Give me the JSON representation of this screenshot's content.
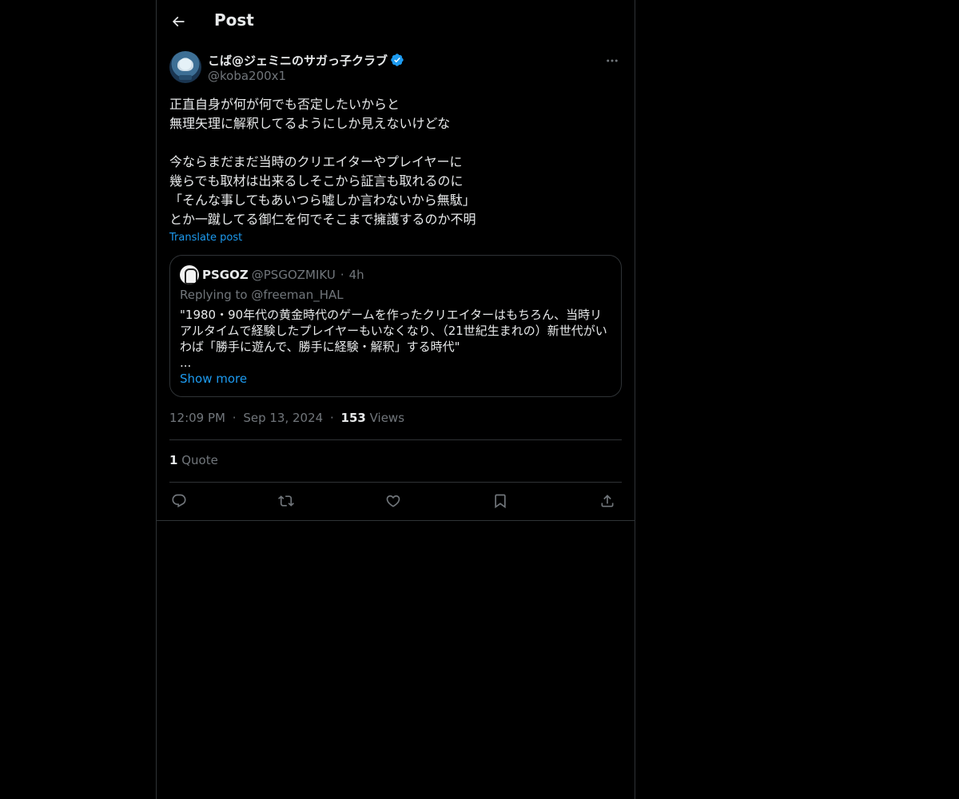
{
  "header": {
    "title": "Post"
  },
  "author": {
    "display_name": "こば@ジェミニのサガっ子クラブ",
    "handle": "@koba200x1",
    "verified": true
  },
  "post": {
    "text": "正直自身が何が何でも否定したいからと\n無理矢理に解釈してるようにしか見えないけどな\n\n今ならまだまだ当時のクリエイターやプレイヤーに\n幾らでも取材は出来るしそこから証言も取れるのに\n「そんな事してもあいつら嘘しか言わないから無駄」\nとか一蹴してる御仁を何でそこまで擁護するのか不明",
    "translate_label": "Translate post"
  },
  "quote": {
    "name": "PSGOZ",
    "handle": "@PSGOZMIKU",
    "separator": "·",
    "time": "4h",
    "replying_to": "Replying to @freeman_HAL",
    "text": "\"1980・90年代の黄金時代のゲームを作ったクリエイターはもちろん、当時リアルタイムで経験したプレイヤーもいなくなり、（21世紀生まれの）新世代がいわば「勝手に遊んで、勝手に経験・解釈」する時代\"\n...",
    "show_more": "Show more"
  },
  "meta": {
    "time": "12:09 PM",
    "separator": "·",
    "date": "Sep 13, 2024",
    "views_count": "153",
    "views_label": "Views"
  },
  "stats": {
    "quote_count": "1",
    "quote_label": "Quote"
  },
  "actions": [
    "reply-icon",
    "repost-icon",
    "like-icon",
    "bookmark-icon",
    "share-icon"
  ],
  "colors": {
    "background": "#000000",
    "text": "#e7e9ea",
    "secondary": "#71767b",
    "accent": "#1d9bf0",
    "border": "#2f3336"
  }
}
